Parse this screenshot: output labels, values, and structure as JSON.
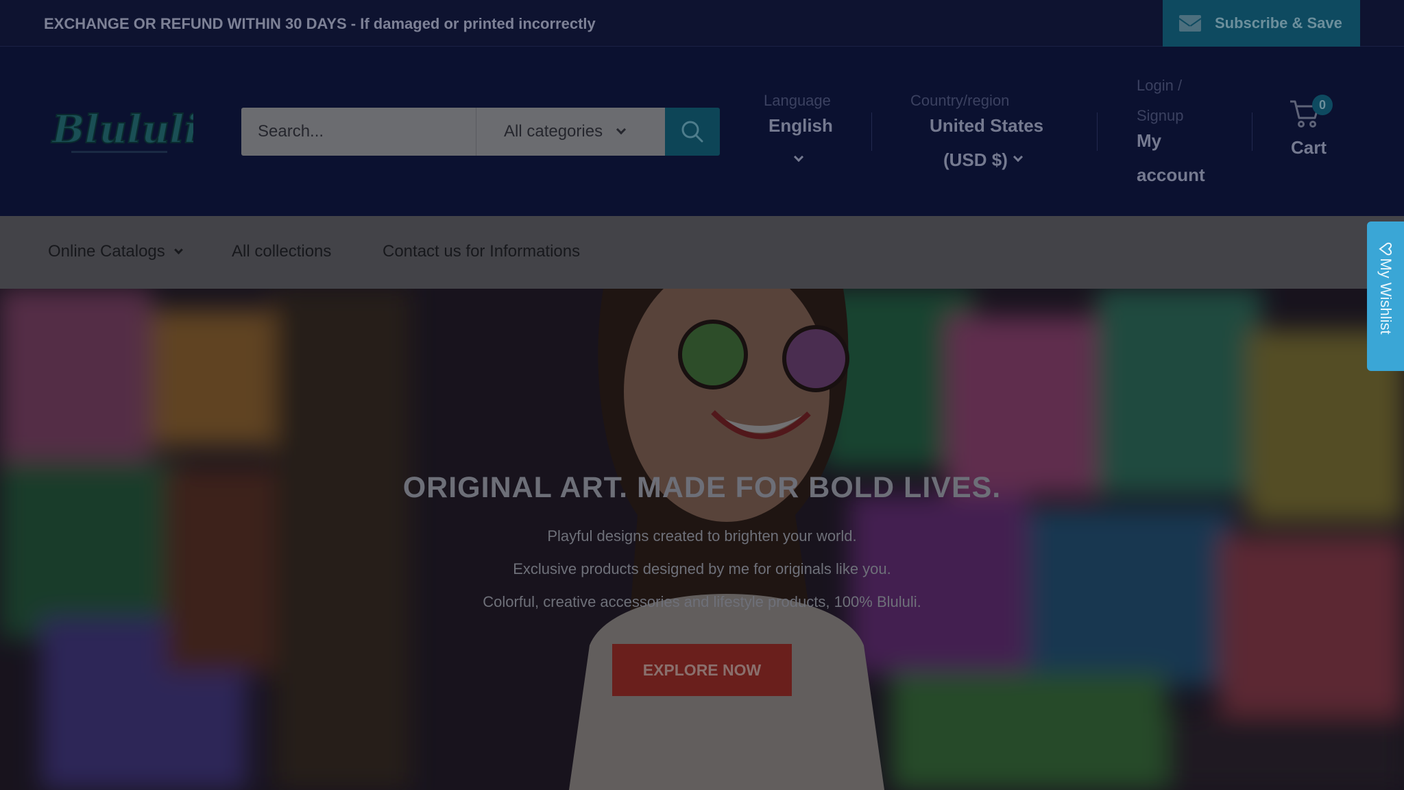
{
  "announcement": {
    "text": "EXCHANGE OR REFUND WITHIN 30 DAYS - If damaged or printed incorrectly",
    "subscribe_label": "Subscribe & Save"
  },
  "header": {
    "logo_text": "Blululi",
    "search": {
      "placeholder": "Search...",
      "category": "All categories"
    },
    "language": {
      "label": "Language",
      "value": "English"
    },
    "country": {
      "label": "Country/region",
      "value_line1": "United States",
      "value_line2": "(USD $)"
    },
    "account": {
      "login_line1": "Login /",
      "login_line2": "Signup",
      "account_line1": "My",
      "account_line2": "account"
    },
    "cart": {
      "label": "Cart",
      "count": "0"
    }
  },
  "nav": {
    "items": [
      {
        "label": "Online Catalogs"
      },
      {
        "label": "All collections"
      },
      {
        "label": "Contact us for Informations"
      }
    ]
  },
  "hero": {
    "title": "ORIGINAL ART. MADE FOR BOLD LIVES.",
    "lines": [
      "Playful designs created to brighten your world.",
      "Exclusive products designed by me for originals like you.",
      "Colorful, creative accessories and lifestyle products, 100% Blululi."
    ],
    "cta": "EXPLORE NOW"
  },
  "wishlist": {
    "label": "My Wishlist"
  },
  "colors": {
    "accent_teal": "#0e4a60",
    "cta_red": "#6a1f1c",
    "wishlist_blue": "#3aa6d6",
    "header_navy": "#0b1130"
  }
}
